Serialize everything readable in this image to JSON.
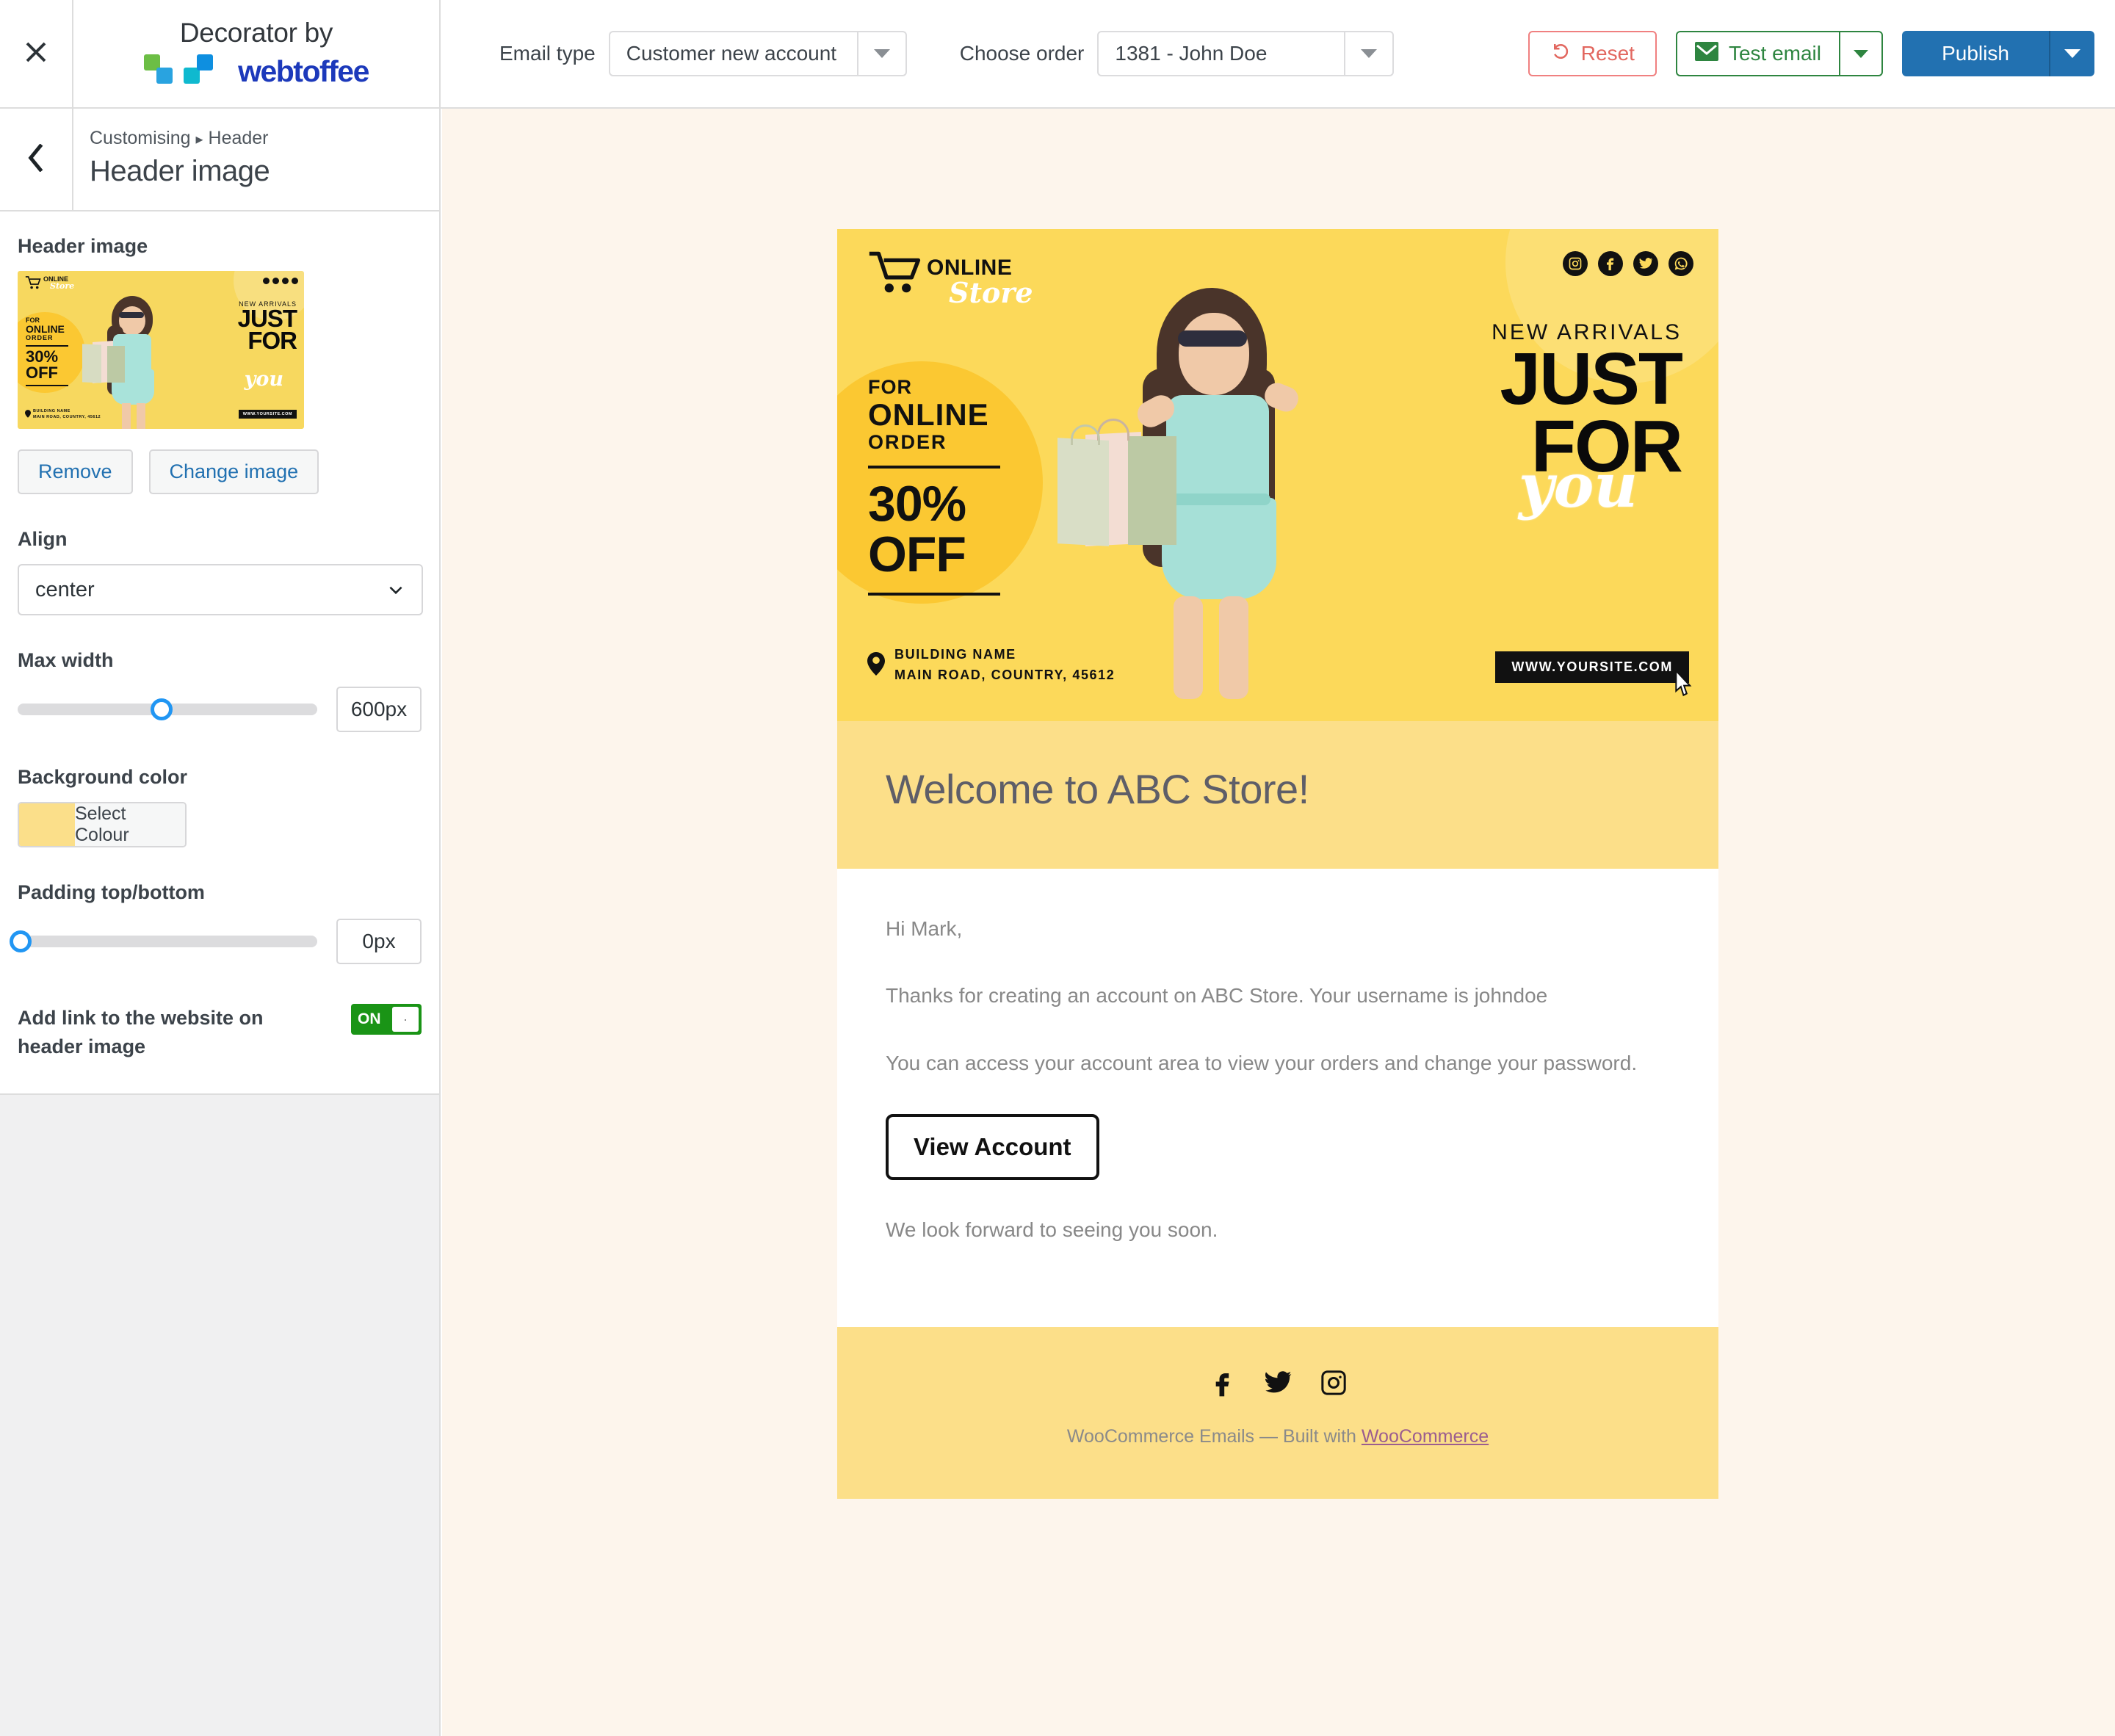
{
  "topbar": {
    "close_icon": "close-icon",
    "brand_title": "Decorator by",
    "brand_word": "webtoffee",
    "email_type_label": "Email type",
    "email_type_value": "Customer new account",
    "choose_order_label": "Choose order",
    "choose_order_value": "1381 - John Doe",
    "reset_label": "Reset",
    "test_email_label": "Test email",
    "publish_label": "Publish"
  },
  "sidebar": {
    "breadcrumb_root": "Customising",
    "breadcrumb_sep": "▸",
    "breadcrumb_current": "Header",
    "panel_title": "Header image",
    "header_image_label": "Header image",
    "remove_label": "Remove",
    "change_image_label": "Change image",
    "align_label": "Align",
    "align_value": "center",
    "max_width_label": "Max width",
    "max_width_value": "600px",
    "background_color_label": "Background color",
    "select_colour_label": "Select Colour",
    "background_color_hex": "#fbdf8a",
    "padding_label": "Padding top/bottom",
    "padding_value": "0px",
    "add_link_label": "Add link to the website on header image",
    "toggle_state": "ON",
    "toggle_off_glyph": "·"
  },
  "banner": {
    "logo_online": "ONLINE",
    "logo_store": "Store",
    "promo_for": "FOR",
    "promo_online": "ONLINE",
    "promo_order": "ORDER",
    "promo_percent": "30%",
    "promo_off": "OFF",
    "new_arrivals": "NEW ARRIVALS",
    "just": "JUST",
    "for": "FOR",
    "you": "you",
    "building_name": "BUILDING NAME",
    "address": "MAIN ROAD, COUNTRY, 45612",
    "url": "WWW.YOURSITE.COM",
    "social": [
      "instagram-icon",
      "facebook-icon",
      "twitter-icon",
      "whatsapp-icon"
    ]
  },
  "email": {
    "heading": "Welcome to ABC Store!",
    "greeting": "Hi Mark,",
    "p1": "Thanks for creating an account on ABC Store. Your username is johndoe",
    "p2": "You can access your account area to view your orders and change your password.",
    "cta_label": "View Account",
    "p3": "We look forward to seeing you soon.",
    "footer_credit_prefix": "WooCommerce Emails — Built with ",
    "footer_credit_link": "WooCommerce",
    "footer_social": [
      "facebook-icon",
      "twitter-icon",
      "instagram-icon"
    ]
  },
  "colors": {
    "canvas_bg": "#fdf5ec",
    "band_bg": "#fcdf89",
    "banner_bg": "#fcd95a",
    "publish_blue": "#2271b1",
    "reset_red": "#e2675f",
    "test_green": "#2e8540",
    "toggle_green": "#1a9416"
  }
}
